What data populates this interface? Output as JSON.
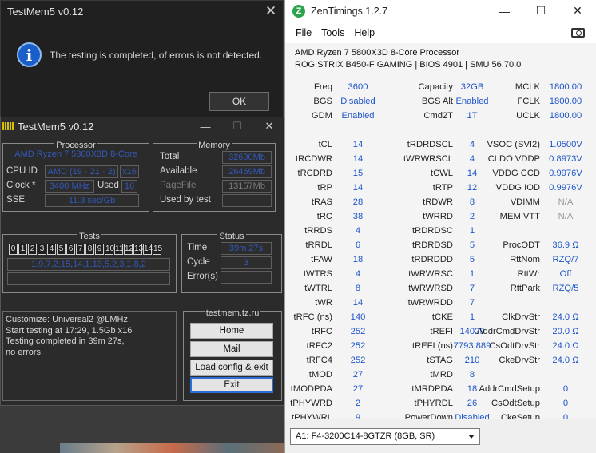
{
  "dialog": {
    "title": "TestMem5 v0.12",
    "close_glyph": "✕",
    "info_glyph": "i",
    "message": "The testing is completed, of errors is not detected.",
    "ok_label": "OK"
  },
  "testmem": {
    "title": "TestMem5 v0.12",
    "min_glyph": "—",
    "max_glyph": "☐",
    "close_glyph": "✕",
    "processor": {
      "group_title": "Processor",
      "cpu_name": "AMD Ryzen 7 5800X3D 8-Core",
      "cpu_id_label": "CPU ID",
      "cpu_id_value": "AMD  (19 · 21 · 2)",
      "cpu_id_threads": "x16",
      "clock_label": "Clock *",
      "clock_value": "3400 MHz",
      "used_label": "Used",
      "used_value": "16",
      "sse_label": "SSE",
      "sse_value": "11.3 sec/Gb"
    },
    "memory": {
      "group_title": "Memory",
      "total_label": "Total",
      "total_value": "32690Mb",
      "available_label": "Available",
      "available_value": "26469Mb",
      "pagefile_label": "PageFile",
      "pagefile_value": "13157Mb",
      "usedbytest_label": "Used by test",
      "usedbytest_value": ""
    },
    "tests": {
      "group_title": "Tests",
      "numbers": [
        "0",
        "1",
        "2",
        "3",
        "4",
        "5",
        "6",
        "7",
        "8",
        "9",
        "10",
        "11",
        "12",
        "13",
        "14",
        "15"
      ],
      "sequence": "1,9,7,2,15,14,1,13,5,2,3,1,8,2",
      "extra": ""
    },
    "status": {
      "group_title": "Status",
      "time_label": "Time",
      "time_value": "39m 27s",
      "cycle_label": "Cycle",
      "cycle_value": "3",
      "errors_label": "Error(s)",
      "errors_value": ""
    },
    "log": "Customize: Universal2 @LMHz\nStart testing at 17:29, 1.5Gb x16\nTesting completed in 39m 27s,\nno errors.",
    "site": {
      "group_title": "testmem.tz.ru",
      "home_label": "Home",
      "mail_label": "Mail",
      "load_label": "Load config & exit",
      "exit_label": "Exit"
    }
  },
  "zentimings": {
    "title": "ZenTimings 1.2.7",
    "logo_glyph": "Z",
    "win_min": "—",
    "win_max": "☐",
    "win_close": "✕",
    "menu": [
      "File",
      "Tools",
      "Help"
    ],
    "cpu": "AMD Ryzen 7 5800X3D 8-Core Processor",
    "board": "ROG STRIX B450-F GAMING | BIOS 4901 | SMU 56.70.0",
    "col1": [
      {
        "label": "Freq",
        "value": "3600"
      },
      {
        "label": "BGS",
        "value": "Disabled"
      },
      {
        "label": "GDM",
        "value": "Enabled"
      },
      {
        "label": "",
        "value": ""
      },
      {
        "label": "tCL",
        "value": "14"
      },
      {
        "label": "tRCDWR",
        "value": "14"
      },
      {
        "label": "tRCDRD",
        "value": "15"
      },
      {
        "label": "tRP",
        "value": "14"
      },
      {
        "label": "tRAS",
        "value": "28"
      },
      {
        "label": "tRC",
        "value": "38"
      },
      {
        "label": "tRRDS",
        "value": "4"
      },
      {
        "label": "tRRDL",
        "value": "6"
      },
      {
        "label": "tFAW",
        "value": "18"
      },
      {
        "label": "tWTRS",
        "value": "4"
      },
      {
        "label": "tWTRL",
        "value": "8"
      },
      {
        "label": "tWR",
        "value": "14"
      },
      {
        "label": "tRFC (ns)",
        "value": "140"
      },
      {
        "label": "tRFC",
        "value": "252"
      },
      {
        "label": "tRFC2",
        "value": "252"
      },
      {
        "label": "tRFC4",
        "value": "252"
      },
      {
        "label": "tMOD",
        "value": "27"
      },
      {
        "label": "tMODPDA",
        "value": "27"
      },
      {
        "label": "tPHYWRD",
        "value": "2"
      },
      {
        "label": "tPHYWRL",
        "value": "9"
      }
    ],
    "col2": [
      {
        "label": "Capacity",
        "value": "32GB"
      },
      {
        "label": "BGS Alt",
        "value": "Enabled"
      },
      {
        "label": "Cmd2T",
        "value": "1T"
      },
      {
        "label": "",
        "value": ""
      },
      {
        "label": "tRDRDSCL",
        "value": "4"
      },
      {
        "label": "tWRWRSCL",
        "value": "4"
      },
      {
        "label": "tCWL",
        "value": "14"
      },
      {
        "label": "tRTP",
        "value": "12"
      },
      {
        "label": "tRDWR",
        "value": "8"
      },
      {
        "label": "tWRRD",
        "value": "2"
      },
      {
        "label": "tRDRDSC",
        "value": "1"
      },
      {
        "label": "tRDRDSD",
        "value": "5"
      },
      {
        "label": "tRDRDDD",
        "value": "5"
      },
      {
        "label": "tWRWRSC",
        "value": "1"
      },
      {
        "label": "tWRWRSD",
        "value": "7"
      },
      {
        "label": "tWRWRDD",
        "value": "7"
      },
      {
        "label": "tCKE",
        "value": "1"
      },
      {
        "label": "tREFI",
        "value": "14029"
      },
      {
        "label": "tREFI (ns)",
        "value": "7793.889"
      },
      {
        "label": "tSTAG",
        "value": "210"
      },
      {
        "label": "tMRD",
        "value": "8"
      },
      {
        "label": "tMRDPDA",
        "value": "18"
      },
      {
        "label": "tPHYRDL",
        "value": "26"
      },
      {
        "label": "PowerDown",
        "value": "Disabled"
      }
    ],
    "col3": [
      {
        "label": "MCLK",
        "value": "1800.00",
        "na": false
      },
      {
        "label": "FCLK",
        "value": "1800.00",
        "na": false
      },
      {
        "label": "UCLK",
        "value": "1800.00",
        "na": false
      },
      {
        "label": "",
        "value": "",
        "na": false
      },
      {
        "label": "VSOC (SVI2)",
        "value": "1.0500V",
        "na": false
      },
      {
        "label": "CLDO VDDP",
        "value": "0.8973V",
        "na": false
      },
      {
        "label": "VDDG CCD",
        "value": "0.9976V",
        "na": false
      },
      {
        "label": "VDDG IOD",
        "value": "0.9976V",
        "na": false
      },
      {
        "label": "VDIMM",
        "value": "N/A",
        "na": true
      },
      {
        "label": "MEM VTT",
        "value": "N/A",
        "na": true
      },
      {
        "label": "",
        "value": "",
        "na": false
      },
      {
        "label": "ProcODT",
        "value": "36.9 Ω",
        "na": false
      },
      {
        "label": "RttNom",
        "value": "RZQ/7",
        "na": false
      },
      {
        "label": "RttWr",
        "value": "Off",
        "na": false
      },
      {
        "label": "RttPark",
        "value": "RZQ/5",
        "na": false
      },
      {
        "label": "",
        "value": "",
        "na": false
      },
      {
        "label": "ClkDrvStr",
        "value": "24.0 Ω",
        "na": false
      },
      {
        "label": "AddrCmdDrvStr",
        "value": "20.0 Ω",
        "na": false
      },
      {
        "label": "CsOdtDrvStr",
        "value": "24.0 Ω",
        "na": false
      },
      {
        "label": "CkeDrvStr",
        "value": "24.0 Ω",
        "na": false
      },
      {
        "label": "",
        "value": "",
        "na": false
      },
      {
        "label": "AddrCmdSetup",
        "value": "0",
        "na": false
      },
      {
        "label": "CsOdtSetup",
        "value": "0",
        "na": false
      },
      {
        "label": "CkeSetup",
        "value": "0",
        "na": false
      }
    ],
    "dimm_selector": "A1: F4-3200C14-8GTZR (8GB, SR)"
  }
}
